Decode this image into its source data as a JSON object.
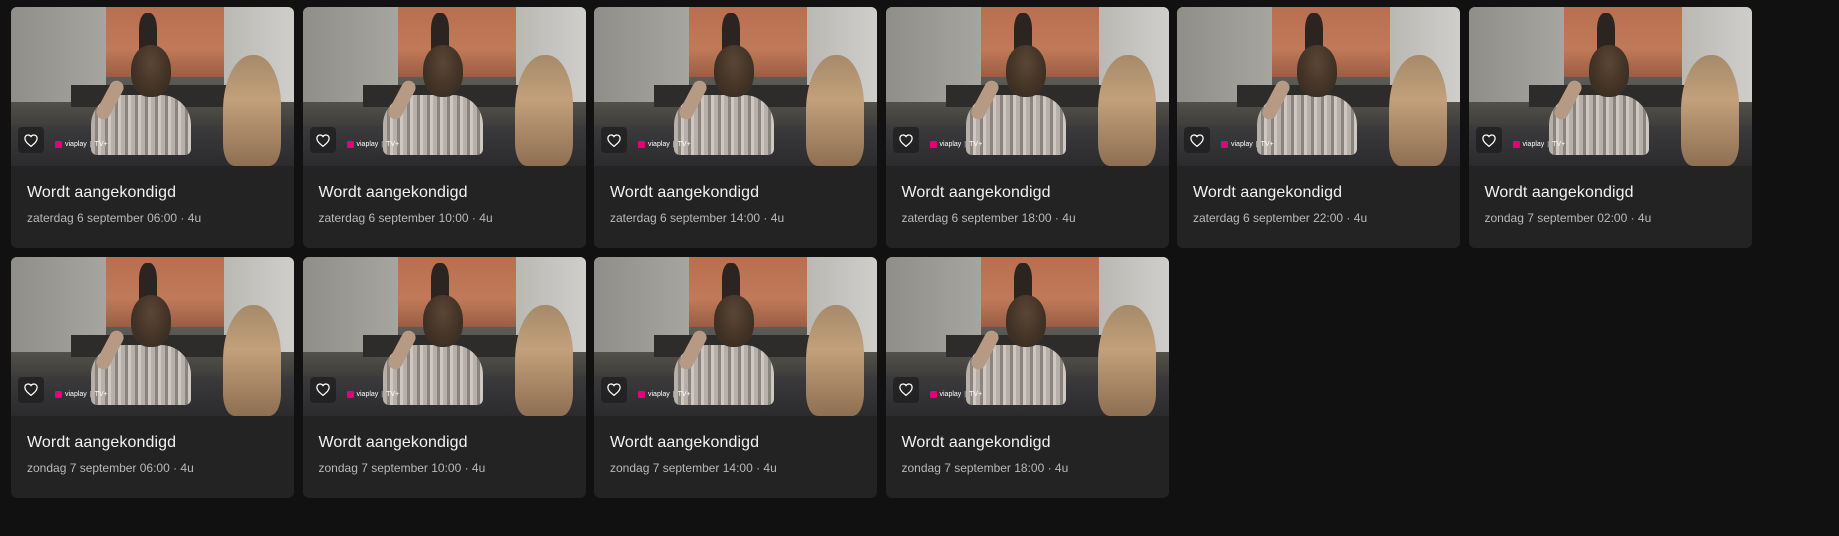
{
  "items": [
    {
      "title": "Wordt aangekondigd",
      "meta": "zaterdag 6 september 06:00 · 4u"
    },
    {
      "title": "Wordt aangekondigd",
      "meta": "zaterdag 6 september 10:00 · 4u"
    },
    {
      "title": "Wordt aangekondigd",
      "meta": "zaterdag 6 september 14:00 · 4u"
    },
    {
      "title": "Wordt aangekondigd",
      "meta": "zaterdag 6 september 18:00 · 4u"
    },
    {
      "title": "Wordt aangekondigd",
      "meta": "zaterdag 6 september 22:00 · 4u"
    },
    {
      "title": "Wordt aangekondigd",
      "meta": "zondag 7 september 02:00 · 4u"
    },
    {
      "title": "Wordt aangekondigd",
      "meta": "zondag 7 september 06:00 · 4u"
    },
    {
      "title": "Wordt aangekondigd",
      "meta": "zondag 7 september 10:00 · 4u"
    },
    {
      "title": "Wordt aangekondigd",
      "meta": "zondag 7 september 14:00 · 4u"
    },
    {
      "title": "Wordt aangekondigd",
      "meta": "zondag 7 september 18:00 · 4u"
    }
  ],
  "brand": {
    "name": "viaplay",
    "sub": "TV+",
    "color": "#e3007a"
  },
  "icons": {
    "favorite": "heart-outline-icon"
  },
  "colors": {
    "background": "#111111",
    "card": "#232323",
    "title": "#f2f2f2",
    "meta": "#b9b9b9"
  }
}
